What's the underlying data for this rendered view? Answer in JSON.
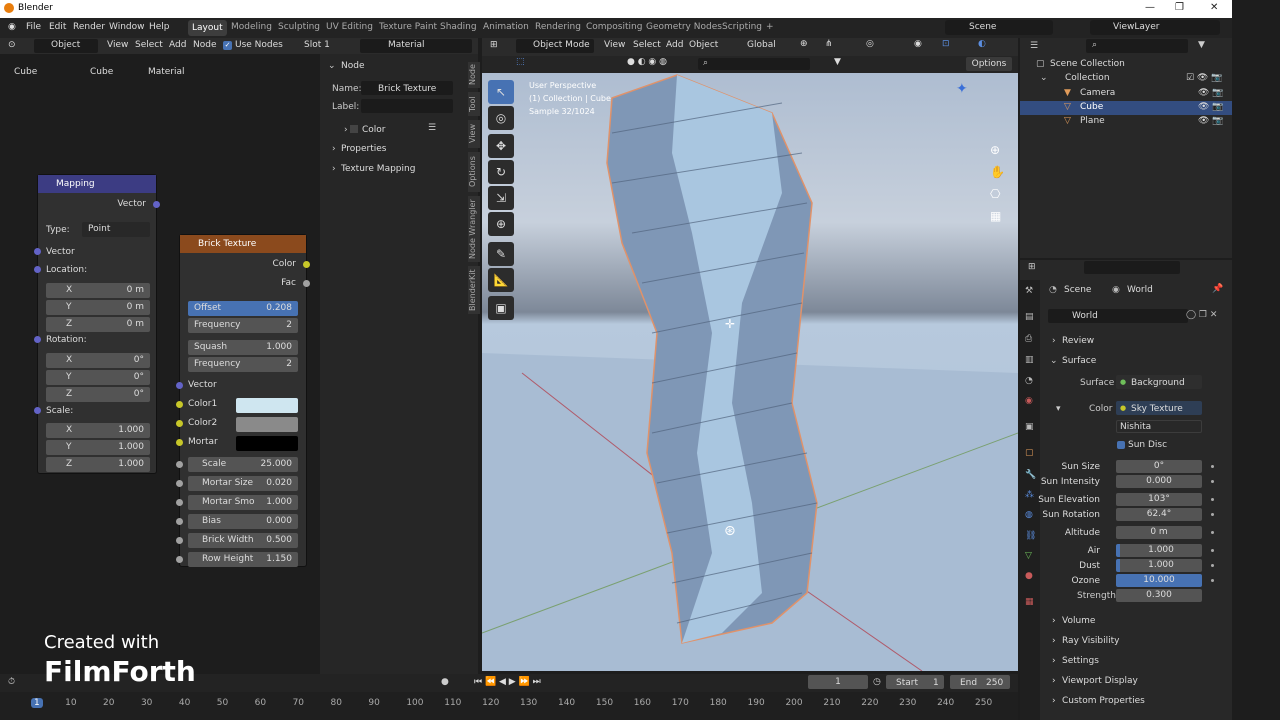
{
  "app": {
    "title": "Blender"
  },
  "menu": {
    "file": "File",
    "edit": "Edit",
    "render": "Render",
    "window": "Window",
    "help": "Help"
  },
  "workspaces": [
    "Layout",
    "Modeling",
    "Sculpting",
    "UV Editing",
    "Texture Paint",
    "Shading",
    "Animation",
    "Rendering",
    "Compositing",
    "Geometry Nodes",
    "Scripting"
  ],
  "active_workspace": "Layout",
  "scene": "Scene",
  "view_layer": "ViewLayer",
  "node_editor": {
    "object_mode": "Object",
    "view": "View",
    "select": "Select",
    "add": "Add",
    "node": "Node",
    "use_nodes": "Use Nodes",
    "slot": "Slot 1",
    "material": "Material",
    "breadcrumb": [
      "Cube",
      "Cube",
      "Material"
    ]
  },
  "mapping": {
    "title": "Mapping",
    "vector_out": "Vector",
    "type_label": "Type:",
    "type_value": "Point",
    "vector_in": "Vector",
    "location": "Location:",
    "rotation": "Rotation:",
    "scale": "Scale:",
    "loc": [
      {
        "a": "X",
        "v": "0 m"
      },
      {
        "a": "Y",
        "v": "0 m"
      },
      {
        "a": "Z",
        "v": "0 m"
      }
    ],
    "rot": [
      {
        "a": "X",
        "v": "0°"
      },
      {
        "a": "Y",
        "v": "0°"
      },
      {
        "a": "Z",
        "v": "0°"
      }
    ],
    "scl": [
      {
        "a": "X",
        "v": "1.000"
      },
      {
        "a": "Y",
        "v": "1.000"
      },
      {
        "a": "Z",
        "v": "1.000"
      }
    ]
  },
  "brick": {
    "title": "Brick Texture",
    "color_out": "Color",
    "fac_out": "Fac",
    "offset": {
      "l": "Offset",
      "v": "0.208"
    },
    "frequency1": {
      "l": "Frequency",
      "v": "2"
    },
    "squash": {
      "l": "Squash",
      "v": "1.000"
    },
    "frequency2": {
      "l": "Frequency",
      "v": "2"
    },
    "vector": "Vector",
    "color1": "Color1",
    "color2": "Color2",
    "mortar": "Mortar",
    "inputs": [
      {
        "l": "Scale",
        "v": "25.000"
      },
      {
        "l": "Mortar Size",
        "v": "0.020"
      },
      {
        "l": "Mortar Smo",
        "v": "1.000"
      },
      {
        "l": "Bias",
        "v": "0.000"
      },
      {
        "l": "Brick Width",
        "v": "0.500"
      },
      {
        "l": "Row Height",
        "v": "1.150"
      }
    ],
    "color1_hex": "#cfe6f0",
    "color2_hex": "#8a8a8a",
    "mortar_hex": "#000000"
  },
  "node_panel": {
    "section": "Node",
    "name_label": "Name:",
    "name_value": "Brick Texture",
    "label_label": "Label:",
    "color": "Color",
    "properties": "Properties",
    "texture_mapping": "Texture Mapping",
    "tabs": [
      "Node",
      "Tool",
      "View",
      "Options",
      "Node Wrangler",
      "BlenderKit"
    ]
  },
  "viewport": {
    "mode": "Object Mode",
    "view": "View",
    "select": "Select",
    "add": "Add",
    "object": "Object",
    "transform": "Global",
    "options": "Options",
    "info1": "User Perspective",
    "info2": "(1) Collection | Cube",
    "info3": "Sample 32/1024"
  },
  "outliner": {
    "root": "Scene Collection",
    "collection": "Collection",
    "items": [
      "Camera",
      "Cube",
      "Plane"
    ]
  },
  "properties": {
    "scene": "Scene",
    "world": "World",
    "world_name": "World",
    "review": "Review",
    "surface_section": "Surface",
    "surface_label": "Surface",
    "surface_value": "Background",
    "color_label": "Color",
    "color_value": "Sky Texture",
    "sky_type": "Nishita",
    "sun_disc": "Sun Disc",
    "rows": [
      {
        "l": "Sun Size",
        "v": "0°"
      },
      {
        "l": "Sun Intensity",
        "v": "0.000"
      },
      {
        "l": "Sun Elevation",
        "v": "103°"
      },
      {
        "l": "Sun Rotation",
        "v": "62.4°"
      },
      {
        "l": "Altitude",
        "v": "0 m"
      },
      {
        "l": "Air",
        "v": "1.000"
      },
      {
        "l": "Dust",
        "v": "1.000"
      },
      {
        "l": "Ozone",
        "v": "10.000"
      }
    ],
    "strength_label": "Strength",
    "strength_value": "0.300",
    "sections": [
      "Volume",
      "Ray Visibility",
      "Settings",
      "Viewport Display",
      "Custom Properties"
    ]
  },
  "timeline": {
    "current": "1",
    "start_label": "Start",
    "start": "1",
    "end_label": "End",
    "end": "250",
    "ticks": [
      "1",
      "10",
      "20",
      "30",
      "40",
      "50",
      "60",
      "70",
      "80",
      "90",
      "100",
      "110",
      "120",
      "130",
      "140",
      "150",
      "160",
      "170",
      "180",
      "190",
      "200",
      "210",
      "220",
      "230",
      "240",
      "250"
    ]
  },
  "watermark": {
    "line1": "Created with",
    "line2": "FilmForth"
  }
}
